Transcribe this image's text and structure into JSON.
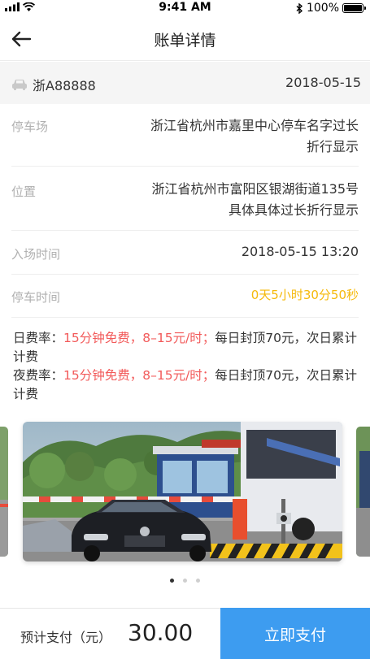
{
  "status_bar": {
    "time": "9:41 AM",
    "battery": "100%"
  },
  "nav": {
    "title": "账单详情"
  },
  "plate": {
    "number": "浙A88888",
    "date": "2018-05-15"
  },
  "rows": {
    "lot": {
      "label": "停车场",
      "value_line1": "浙江省杭州市嘉里中心停车名字过长",
      "value_line2": "折行显示"
    },
    "location": {
      "label": "位置",
      "value_line1": "浙江省杭州市富阳区银湖街道135号",
      "value_line2": "具体具体过长折行显示"
    },
    "entry": {
      "label": "入场时间",
      "value": "2018-05-15 13:20"
    },
    "duration": {
      "label": "停车时间",
      "value": "0天5小时30分50秒"
    }
  },
  "rates": {
    "day_prefix": "日费率：",
    "day_highlight": "15分钟免费，8–15元/时；",
    "day_suffix": "每日封顶70元，次日累计计费",
    "night_prefix": "夜费率：",
    "night_highlight": "15分钟免费，8–15元/时；",
    "night_suffix": "每日封顶70元，次日累计计费"
  },
  "carousel": {
    "slide_count": 3,
    "active_index": 0
  },
  "footer": {
    "total_label": "预计支付（元）",
    "total_amount": "30.00",
    "pay_label": "立即支付"
  },
  "colors": {
    "accent": "#3d9cf0",
    "highlight_red": "#f25a5a",
    "duration_orange": "#f5b90a",
    "muted_label": "#b0b0b0"
  }
}
